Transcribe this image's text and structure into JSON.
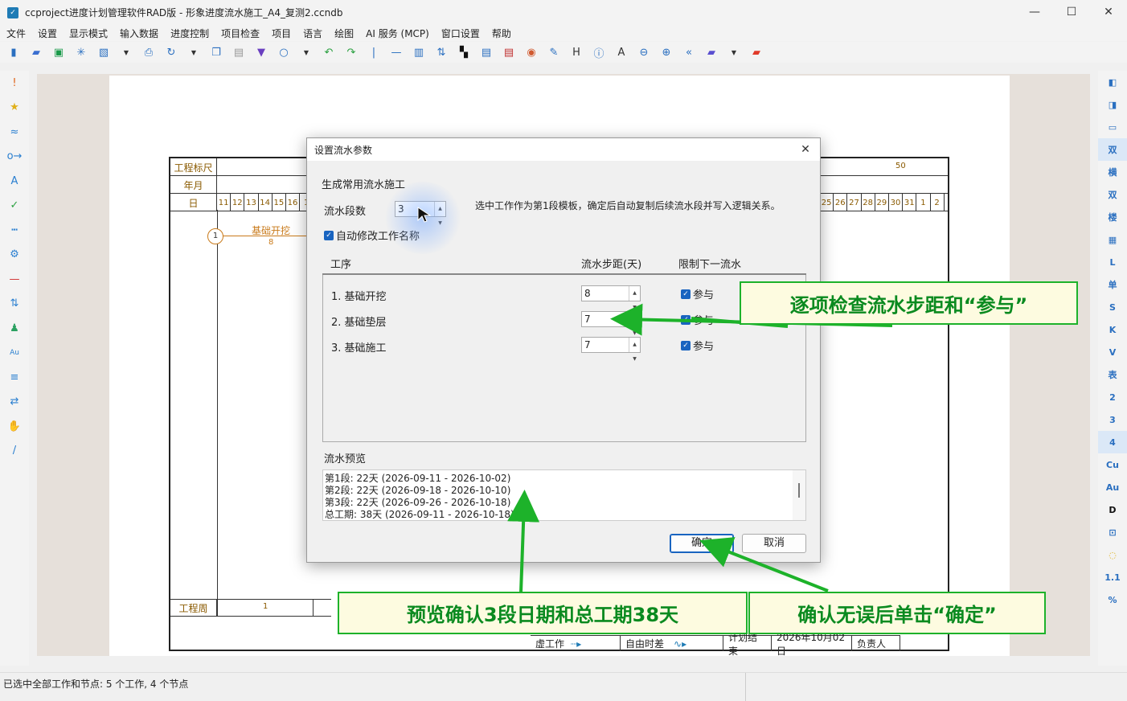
{
  "window": {
    "title": "ccproject进度计划管理软件RAD版 - 形象进度流水施工_A4_复测2.ccndb",
    "minimize": "—",
    "maximize": "☐",
    "close": "✕"
  },
  "menu": [
    "文件",
    "设置",
    "显示模式",
    "输入数据",
    "进度控制",
    "项目检查",
    "项目",
    "语言",
    "绘图",
    "AI 服务 (MCP)",
    "窗口设置",
    "帮助"
  ],
  "toolbar_icons": [
    "new-icon",
    "open-icon",
    "save-icon",
    "star-icon",
    "export-icon",
    "dropdown-icon",
    "print-icon",
    "refresh-icon",
    "dropdown-icon",
    "copy-icon",
    "paste-icon",
    "brush-icon",
    "search-icon",
    "dropdown-icon",
    "undo-icon",
    "redo-icon",
    "separator",
    "line-icon",
    "bars-icon",
    "sort-icon",
    "qr-icon",
    "format-icon",
    "doc-icon",
    "palette-icon",
    "edit-icon",
    "h-icon",
    "info-icon",
    "text-icon",
    "zoom-out-icon",
    "zoom-in-icon",
    "nav-icon",
    "folder-icon",
    "dropdown-icon",
    "folder-red-icon"
  ],
  "right_bar": [
    "◧",
    "◨",
    "▭",
    "双",
    "横",
    "双",
    "楼",
    "▦",
    "L",
    "单",
    "S",
    "K",
    "V",
    "表",
    "2",
    "3",
    "4",
    "Cu",
    "Au",
    "D",
    "⊡",
    "◌",
    "1.1",
    "%"
  ],
  "sheet": {
    "ruler_label": "工程标尺",
    "ruler_mark": "50",
    "month_label": "年月",
    "day_label": "日",
    "days_left": [
      "11",
      "12",
      "13",
      "14",
      "15",
      "16",
      "1"
    ],
    "days_right": [
      "25",
      "26",
      "27",
      "28",
      "29",
      "30",
      "31",
      "1",
      "2"
    ],
    "node_id": "1",
    "task_name": "基础开挖",
    "task_duration": "8",
    "week_label": "工程周",
    "week_value": "1",
    "legend": {
      "dummy": "虚工作",
      "free_float": "自由时差",
      "plan_end_label": "计划结束",
      "plan_end_value": "2026年10月02日",
      "owner": "负责人"
    }
  },
  "status": {
    "text": "已选中全部工作和节点: 5 个工作, 4 个节点"
  },
  "dialog": {
    "title": "设置流水参数",
    "section": "生成常用流水施工",
    "segments_label": "流水段数",
    "segments_value": "3",
    "hint": "选中工作作为第1段模板，确定后自动复制后续流水段并写入逻辑关系。",
    "auto_rename": "自动修改工作名称",
    "col_process": "工序",
    "col_step": "流水步距(天)",
    "col_limit": "限制下一流水",
    "rows": [
      {
        "name": "1. 基础开挖",
        "step": "8",
        "participate": "参与"
      },
      {
        "name": "2. 基础垫层",
        "step": "7",
        "participate": "参与"
      },
      {
        "name": "3. 基础施工",
        "step": "7",
        "participate": "参与"
      }
    ],
    "preview_label": "流水预览",
    "preview_lines": [
      "第1段: 22天 (2026-09-11 - 2026-10-02)",
      "第2段: 22天 (2026-09-18 - 2026-10-10)",
      "第3段: 22天 (2026-09-26 - 2026-10-18)",
      "总工期: 38天 (2026-09-11 - 2026-10-18)"
    ],
    "ok": "确定",
    "cancel": "取消"
  },
  "annotations": {
    "check_steps": "逐项检查流水步距和“参与”",
    "preview_confirm": "预览确认3段日期和总工期38天",
    "click_ok": "确认无误后单击“确定”",
    "color": "#1db22a"
  }
}
